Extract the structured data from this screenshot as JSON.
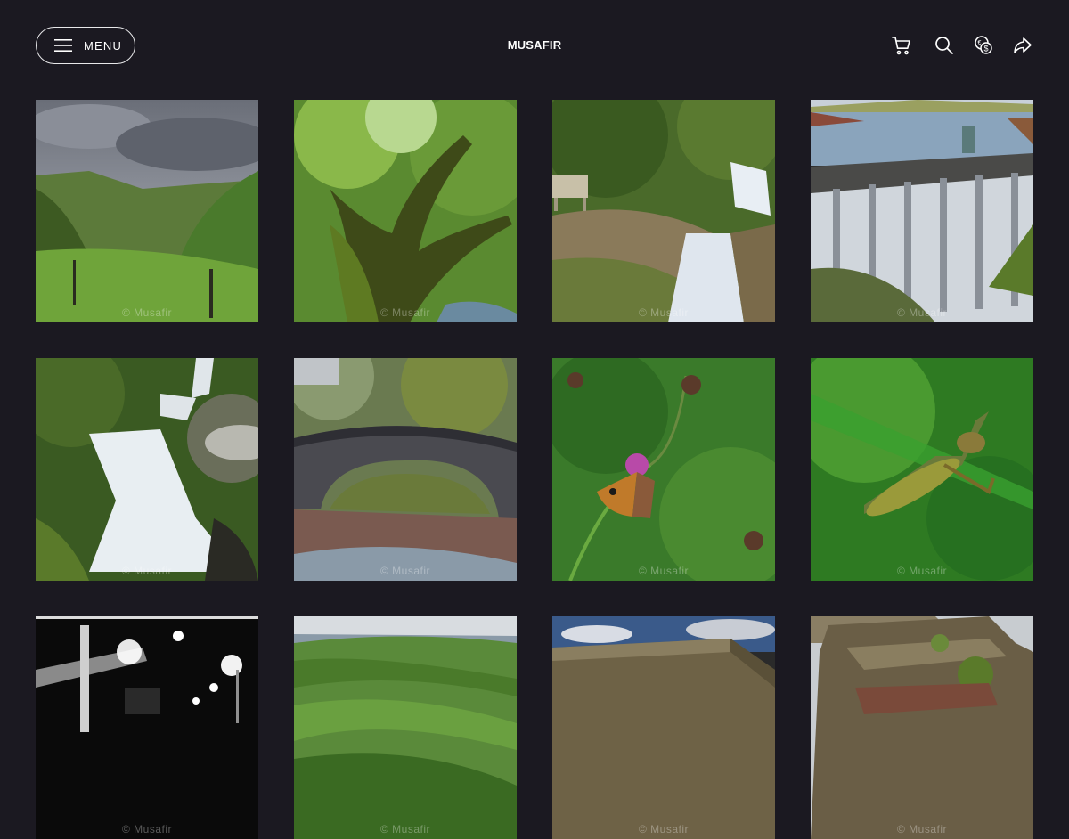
{
  "header": {
    "menu_label": "MENU",
    "brand": "MUSAFIR",
    "icons": [
      "cart-icon",
      "search-icon",
      "currency-icon",
      "share-icon"
    ]
  },
  "gallery": {
    "watermark": "© Musafir",
    "photos": [
      {
        "subject": "valley-clouds"
      },
      {
        "subject": "mossy-tree"
      },
      {
        "subject": "waterfall-bench"
      },
      {
        "subject": "dam"
      },
      {
        "subject": "mountain-waterfall"
      },
      {
        "subject": "stone-bridge"
      },
      {
        "subject": "butterfly-thistle"
      },
      {
        "subject": "grasshopper"
      },
      {
        "subject": "night-street"
      },
      {
        "subject": "green-hills"
      },
      {
        "subject": "stone-ruin"
      },
      {
        "subject": "stone-ruin-grass"
      }
    ]
  },
  "colors": {
    "background": "#1b1921",
    "text": "#ffffff"
  }
}
